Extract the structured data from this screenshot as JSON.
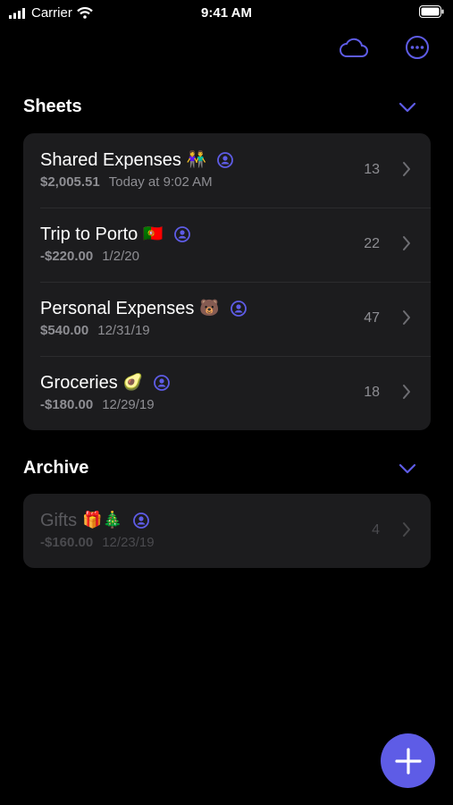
{
  "status_bar": {
    "carrier": "Carrier",
    "time": "9:41 AM"
  },
  "toolbar": {
    "cloud_icon": "cloud-icon",
    "more_icon": "ellipsis-circle-icon"
  },
  "accent_color": "#5e5ce6",
  "sections": {
    "sheets": {
      "title": "Sheets",
      "items": [
        {
          "title": "Shared Expenses",
          "emoji": "👫",
          "amount": "$2,005.51",
          "date": "Today at 9:02 AM",
          "count": "13"
        },
        {
          "title": "Trip to Porto",
          "emoji": "🇵🇹",
          "amount": "-$220.00",
          "date": "1/2/20",
          "count": "22"
        },
        {
          "title": "Personal Expenses",
          "emoji": "🐻",
          "amount": "$540.00",
          "date": "12/31/19",
          "count": "47"
        },
        {
          "title": "Groceries",
          "emoji": "🥑",
          "amount": "-$180.00",
          "date": "12/29/19",
          "count": "18"
        }
      ]
    },
    "archive": {
      "title": "Archive",
      "items": [
        {
          "title": "Gifts",
          "emoji": "🎁🎄",
          "amount": "-$160.00",
          "date": "12/23/19",
          "count": "4"
        }
      ]
    }
  },
  "fab": {
    "icon": "plus-icon"
  }
}
